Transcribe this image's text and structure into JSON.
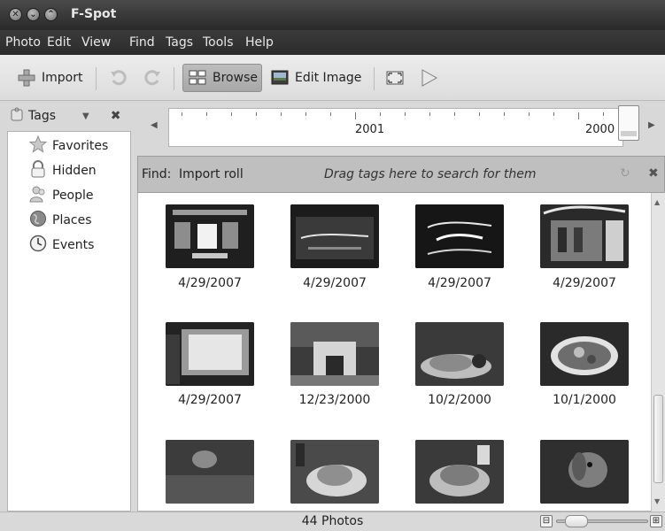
{
  "window": {
    "title": "F-Spot"
  },
  "menu": [
    "Photo",
    "Edit",
    "View",
    "Find",
    "Tags",
    "Tools",
    "Help"
  ],
  "toolbar": {
    "import_label": "Import",
    "browse_label": "Browse",
    "edit_label": "Edit Image"
  },
  "sidebar": {
    "header_label": "Tags",
    "items": [
      {
        "label": "Favorites",
        "icon": "star-icon"
      },
      {
        "label": "Hidden",
        "icon": "lock-icon"
      },
      {
        "label": "People",
        "icon": "people-icon"
      },
      {
        "label": "Places",
        "icon": "globe-icon"
      },
      {
        "label": "Events",
        "icon": "clock-icon"
      }
    ]
  },
  "timeline": {
    "years": [
      "2001",
      "2000"
    ]
  },
  "find": {
    "label": "Find:",
    "roll": "Import roll",
    "hint": "Drag tags here to search for them"
  },
  "photos": [
    {
      "date": "4/29/2007"
    },
    {
      "date": "4/29/2007"
    },
    {
      "date": "4/29/2007"
    },
    {
      "date": "4/29/2007"
    },
    {
      "date": "4/29/2007"
    },
    {
      "date": "12/23/2000"
    },
    {
      "date": "10/2/2000"
    },
    {
      "date": "10/1/2000"
    },
    {
      "date": ""
    },
    {
      "date": ""
    },
    {
      "date": ""
    },
    {
      "date": ""
    }
  ],
  "status": {
    "text": "44 Photos"
  }
}
